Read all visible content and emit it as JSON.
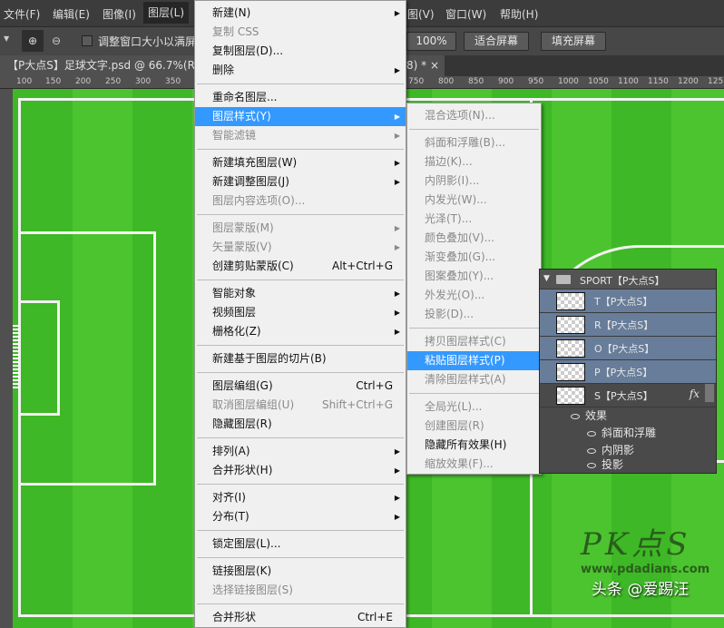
{
  "menubar": {
    "items": [
      "文件(F)",
      "编辑(E)",
      "图像(I)",
      "图层(L)",
      "图(V)",
      "窗口(W)",
      "帮助(H)"
    ]
  },
  "options": {
    "resize_label": "调整窗口大小以满屏",
    "zoom_100": "100%",
    "fit_screen": "适合屏幕",
    "fill_screen": "填充屏幕"
  },
  "tab": {
    "title": "【P大点S】足球文字.psd @ 66.7%(RG",
    "suffix": "8) * ×"
  },
  "ruler": [
    "100",
    "150",
    "200",
    "250",
    "300",
    "350",
    "750",
    "800",
    "850",
    "900",
    "950",
    "1000",
    "1050",
    "1100",
    "1150",
    "1200",
    "125"
  ],
  "layer_menu": [
    {
      "label": "新建(N)",
      "sub": true
    },
    {
      "label": "复制 CSS",
      "disabled": true
    },
    {
      "label": "复制图层(D)..."
    },
    {
      "label": "删除",
      "sub": true
    },
    {
      "sep": true
    },
    {
      "label": "重命名图层..."
    },
    {
      "label": "图层样式(Y)",
      "sub": true,
      "highlight": true
    },
    {
      "label": "智能滤镜",
      "sub": true,
      "disabled": true
    },
    {
      "sep": true
    },
    {
      "label": "新建填充图层(W)",
      "sub": true
    },
    {
      "label": "新建调整图层(J)",
      "sub": true
    },
    {
      "label": "图层内容选项(O)...",
      "disabled": true
    },
    {
      "sep": true
    },
    {
      "label": "图层蒙版(M)",
      "sub": true,
      "disabled": true
    },
    {
      "label": "矢量蒙版(V)",
      "sub": true,
      "disabled": true
    },
    {
      "label": "创建剪贴蒙版(C)",
      "shortcut": "Alt+Ctrl+G"
    },
    {
      "sep": true
    },
    {
      "label": "智能对象",
      "sub": true
    },
    {
      "label": "视频图层",
      "sub": true
    },
    {
      "label": "栅格化(Z)",
      "sub": true
    },
    {
      "sep": true
    },
    {
      "label": "新建基于图层的切片(B)"
    },
    {
      "sep": true
    },
    {
      "label": "图层编组(G)",
      "shortcut": "Ctrl+G"
    },
    {
      "label": "取消图层编组(U)",
      "shortcut": "Shift+Ctrl+G",
      "disabled": true
    },
    {
      "label": "隐藏图层(R)"
    },
    {
      "sep": true
    },
    {
      "label": "排列(A)",
      "sub": true
    },
    {
      "label": "合并形状(H)",
      "sub": true
    },
    {
      "sep": true
    },
    {
      "label": "对齐(I)",
      "sub": true
    },
    {
      "label": "分布(T)",
      "sub": true
    },
    {
      "sep": true
    },
    {
      "label": "锁定图层(L)..."
    },
    {
      "sep": true
    },
    {
      "label": "链接图层(K)"
    },
    {
      "label": "选择链接图层(S)",
      "disabled": true
    },
    {
      "sep": true
    },
    {
      "label": "合并形状",
      "shortcut": "Ctrl+E"
    }
  ],
  "style_menu": [
    {
      "label": "混合选项(N)...",
      "disabled": true
    },
    {
      "sep": true
    },
    {
      "label": "斜面和浮雕(B)...",
      "disabled": true
    },
    {
      "label": "描边(K)...",
      "disabled": true
    },
    {
      "label": "内阴影(I)...",
      "disabled": true
    },
    {
      "label": "内发光(W)...",
      "disabled": true
    },
    {
      "label": "光泽(T)...",
      "disabled": true
    },
    {
      "label": "颜色叠加(V)...",
      "disabled": true
    },
    {
      "label": "渐变叠加(G)...",
      "disabled": true
    },
    {
      "label": "图案叠加(Y)...",
      "disabled": true
    },
    {
      "label": "外发光(O)...",
      "disabled": true
    },
    {
      "label": "投影(D)...",
      "disabled": true
    },
    {
      "sep": true
    },
    {
      "label": "拷贝图层样式(C)",
      "disabled": true
    },
    {
      "label": "粘贴图层样式(P)",
      "highlight": true
    },
    {
      "label": "清除图层样式(A)",
      "disabled": true
    },
    {
      "sep": true
    },
    {
      "label": "全局光(L)...",
      "disabled": true
    },
    {
      "label": "创建图层(R)",
      "disabled": true
    },
    {
      "label": "隐藏所有效果(H)"
    },
    {
      "label": "缩放效果(F)...",
      "disabled": true
    }
  ],
  "layers": {
    "group": "SPORT【P大点S】",
    "rows": [
      {
        "name": "T【P大点S】",
        "selected": true
      },
      {
        "name": "R【P大点S】",
        "selected": true
      },
      {
        "name": "O【P大点S】",
        "selected": true
      },
      {
        "name": "P【P大点S】",
        "selected": true
      },
      {
        "name": "S【P大点S】",
        "selected": false,
        "fx": "fx"
      }
    ],
    "effects_label": "效果",
    "effects": [
      "斜面和浮雕",
      "内阴影",
      "投影"
    ]
  },
  "watermark": {
    "logo": "PK点S",
    "url": "www.pdadians.com",
    "credit": "头条 @爱踢汪"
  },
  "colors": {
    "highlight": "#3399ff",
    "field": "#3eb826",
    "layer_selected": "#687d99"
  }
}
